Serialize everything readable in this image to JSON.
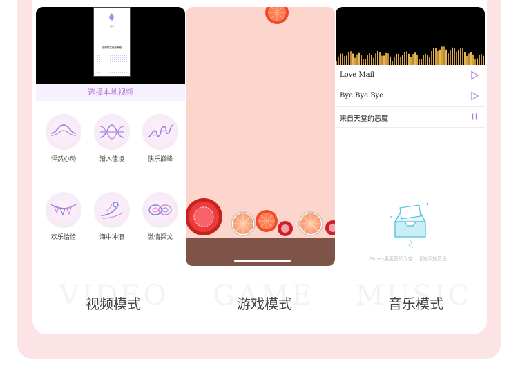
{
  "video_screen": {
    "preview_app_name": "音乐",
    "preview_title": "视频模式使用教程",
    "select_button": "选择本地视频",
    "effects": [
      {
        "label": "怦然心动",
        "icon": "heartbeat-wave-icon"
      },
      {
        "label": "渐入佳境",
        "icon": "crossed-waves-icon"
      },
      {
        "label": "快乐巅峰",
        "icon": "loop-wave-icon"
      },
      {
        "label": "欢乐恰恰",
        "icon": "bunting-flags-icon"
      },
      {
        "label": "海中冲浪",
        "icon": "surf-wave-icon"
      },
      {
        "label": "激情探戈",
        "icon": "infinity-loops-icon"
      }
    ]
  },
  "game_screen": {
    "fruits": [
      "tomato",
      "orange",
      "grapefruit",
      "lychee"
    ]
  },
  "music_screen": {
    "songs": [
      {
        "title": "Love Mail",
        "state": "play-icon"
      },
      {
        "title": "Bye Bye Bye",
        "state": "play-icon"
      },
      {
        "title": "来自天堂的恶魔",
        "state": "pause-icon"
      }
    ],
    "empty_message": "iTunes里面音乐为空，请先添加音乐！"
  },
  "watermarks": [
    "VIDEO",
    "GAME",
    "MUSIC"
  ],
  "mode_labels": [
    "视频模式",
    "游戏模式",
    "音乐模式"
  ],
  "colors": {
    "accent": "#b77ed6",
    "pink_bg": "#fbe3e6",
    "game_bg": "#fcd6cc",
    "ground": "#7e5448"
  }
}
